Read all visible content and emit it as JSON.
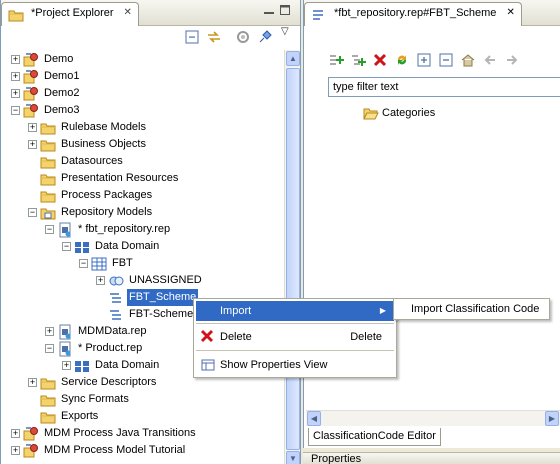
{
  "explorer": {
    "title": "*Project Explorer",
    "tree": [
      {
        "label": "Demo",
        "depth": 0,
        "toggle": "+",
        "icon": "project-icon"
      },
      {
        "label": "Demo1",
        "depth": 0,
        "toggle": "+",
        "icon": "project-icon"
      },
      {
        "label": "Demo2",
        "depth": 0,
        "toggle": "+",
        "icon": "project-icon"
      },
      {
        "label": "Demo3",
        "depth": 0,
        "toggle": "-",
        "icon": "project-icon"
      },
      {
        "label": "Rulebase Models",
        "depth": 1,
        "toggle": "+",
        "icon": "folder-icon"
      },
      {
        "label": "Business Objects",
        "depth": 1,
        "toggle": "+",
        "icon": "folder-icon"
      },
      {
        "label": "Datasources",
        "depth": 1,
        "toggle": "",
        "icon": "folder-icon"
      },
      {
        "label": "Presentation Resources",
        "depth": 1,
        "toggle": "",
        "icon": "folder-icon"
      },
      {
        "label": "Process Packages",
        "depth": 1,
        "toggle": "",
        "icon": "folder-icon"
      },
      {
        "label": "Repository Models",
        "depth": 1,
        "toggle": "-",
        "icon": "repository-models-icon"
      },
      {
        "label": "* fbt_repository.rep",
        "depth": 2,
        "toggle": "-",
        "icon": "repository-file-icon"
      },
      {
        "label": "Data Domain",
        "depth": 3,
        "toggle": "-",
        "icon": "data-domain-icon"
      },
      {
        "label": "FBT",
        "depth": 4,
        "toggle": "-",
        "icon": "table-icon"
      },
      {
        "label": "UNASSIGNED",
        "depth": 5,
        "toggle": "+",
        "icon": "unassigned-icon"
      },
      {
        "label": "FBT_Scheme",
        "depth": 5,
        "toggle": "",
        "icon": "scheme-icon",
        "selected": true
      },
      {
        "label": "FBT-Scheme",
        "depth": 5,
        "toggle": "",
        "icon": "scheme-icon"
      },
      {
        "label": "MDMData.rep",
        "depth": 2,
        "toggle": "+",
        "icon": "repository-file-icon"
      },
      {
        "label": "* Product.rep",
        "depth": 2,
        "toggle": "-",
        "icon": "repository-file-icon"
      },
      {
        "label": "Data Domain",
        "depth": 3,
        "toggle": "+",
        "icon": "data-domain-icon"
      },
      {
        "label": "Service Descriptors",
        "depth": 1,
        "toggle": "+",
        "icon": "folder-icon"
      },
      {
        "label": "Sync Formats",
        "depth": 1,
        "toggle": "",
        "icon": "folder-icon"
      },
      {
        "label": "Exports",
        "depth": 1,
        "toggle": "",
        "icon": "folder-icon"
      },
      {
        "label": "MDM Process Java Transitions",
        "depth": 0,
        "toggle": "+",
        "icon": "project-icon"
      },
      {
        "label": "MDM Process Model Tutorial",
        "depth": 0,
        "toggle": "+",
        "icon": "project-icon"
      }
    ]
  },
  "editor": {
    "title": "*fbt_repository.rep#FBT_Scheme",
    "filter_value": "type filter text",
    "root_item": "Categories",
    "bottom_tab": "ClassificationCode Editor"
  },
  "properties_tab": "Properties",
  "context_menu": {
    "import_label": "Import",
    "delete_label": "Delete",
    "delete_accel": "Delete",
    "show_properties_label": "Show Properties View"
  },
  "submenu": {
    "import_classification_label": "Import Classification Code"
  },
  "colors": {
    "selection": "#316ac5",
    "border": "#7f9db9",
    "delete_red": "#d0141c",
    "add_green": "#2a9d2a"
  }
}
